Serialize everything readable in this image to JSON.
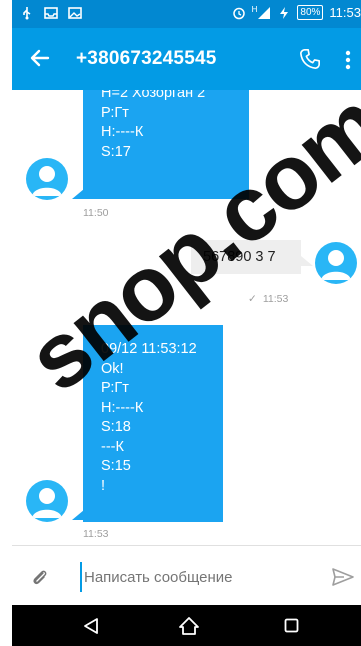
{
  "status_bar": {
    "battery": "80%",
    "clock": "11:53",
    "signal": "H",
    "icons": [
      "usb-icon",
      "inbox-icon",
      "image-icon",
      "alarm-icon",
      "signal-icon",
      "charging-icon"
    ]
  },
  "app_bar": {
    "title": "+380673245545",
    "icons": [
      "back-arrow-icon",
      "phone-icon",
      "overflow-menu-icon"
    ]
  },
  "messages": {
    "incoming_1": {
      "lines": [
        "Н=2 Хозорган 2",
        "Р:Гт",
        "Н:----К",
        "S:17"
      ],
      "time": "11:50"
    },
    "outgoing_1": {
      "text": "567890 3 7",
      "status_time": "11:53"
    },
    "incoming_2": {
      "lines": [
        "09/12 11:53:12",
        "Ok!",
        "Р:Гт",
        "Н:----К",
        "S:18",
        "---К",
        "S:15",
        "!"
      ],
      "time": "11:53"
    }
  },
  "composer": {
    "placeholder": "Написать сообщение",
    "icons": [
      "paperclip-icon",
      "send-icon"
    ]
  },
  "nav_bar": {
    "icons": [
      "nav-back-icon",
      "nav-home-icon",
      "nav-recent-icon"
    ]
  },
  "watermark": {
    "text": "snop.com"
  },
  "colors": {
    "status_bar": "#0288d1",
    "app_bar": "#039be5",
    "incoming_bubble": "#1ba4f1",
    "outgoing_bubble": "#eeeeee",
    "avatar": "#29b6f6"
  }
}
